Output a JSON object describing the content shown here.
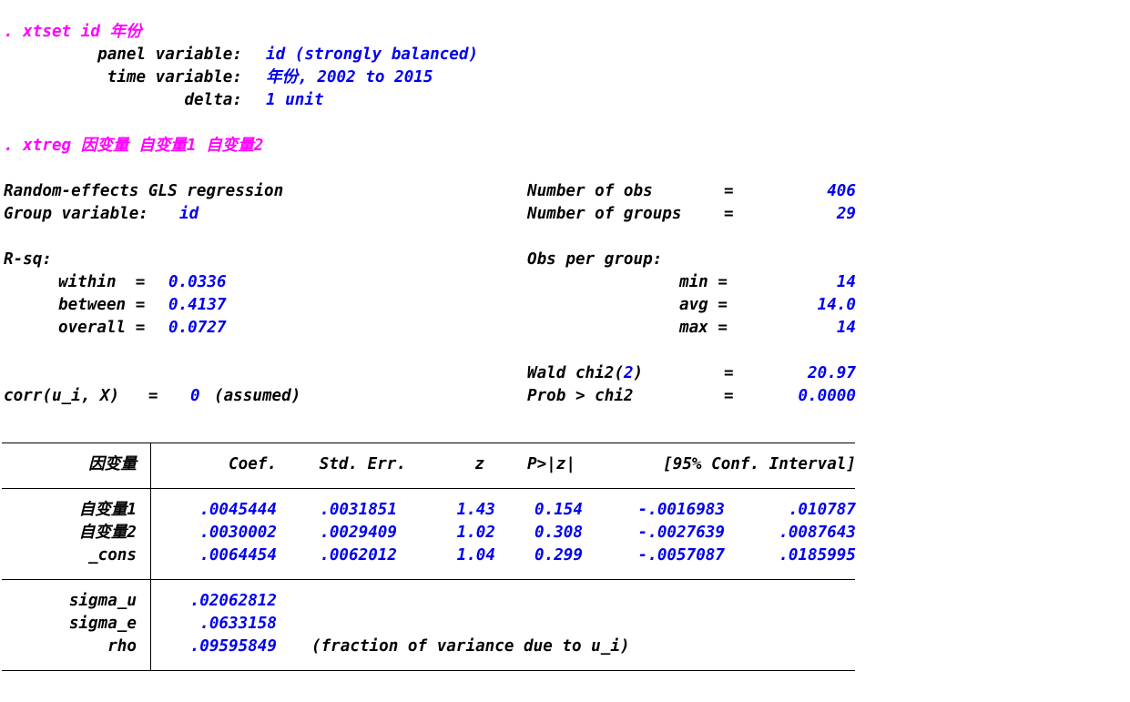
{
  "xtset": {
    "command": ". xtset id 年份",
    "panel_label": "panel variable:",
    "panel_value": "id (strongly balanced)",
    "time_label": "time variable:",
    "time_value": "年份, 2002 to 2015",
    "delta_label": "delta:",
    "delta_value": "1 unit"
  },
  "xtreg": {
    "command": ". xtreg 因变量 自变量1 自变量2",
    "title": "Random-effects GLS regression",
    "group_label": "Group variable:",
    "group_value": "id",
    "nobs_label": "Number of obs",
    "nobs_eq": "=",
    "nobs_value": "406",
    "ngroups_label": "Number of groups",
    "ngroups_eq": "=",
    "ngroups_value": "29",
    "rsq_label": "R-sq:",
    "within_label": "within  =",
    "within_value": "0.0336",
    "between_label": "between =",
    "between_value": "0.4137",
    "overall_label": "overall =",
    "overall_value": "0.0727",
    "obs_per_group_label": "Obs per group:",
    "min_label": "min =",
    "min_value": "14",
    "avg_label": "avg =",
    "avg_value": "14.0",
    "max_label": "max =",
    "max_value": "14",
    "wald_label": "Wald chi2(",
    "wald_df": "2",
    "wald_close": ")",
    "wald_eq": "=",
    "wald_value": "20.97",
    "prob_label": "Prob > chi2",
    "prob_eq": "=",
    "prob_value": "0.0000",
    "corr_label": "corr(u_i, X)   =",
    "corr_value": "0",
    "corr_suffix": "(assumed)"
  },
  "table": {
    "headers": {
      "depvar": "因变量",
      "coef": "Coef.",
      "stderr": "Std. Err.",
      "z": "z",
      "p": "P>|z|",
      "ci": "[95% Conf. Interval]"
    },
    "rows": [
      {
        "name": "自变量1",
        "coef": ".0045444",
        "se": ".0031851",
        "z": "1.43",
        "p": "0.154",
        "lo": "-.0016983",
        "hi": ".010787"
      },
      {
        "name": "自变量2",
        "coef": ".0030002",
        "se": ".0029409",
        "z": "1.02",
        "p": "0.308",
        "lo": "-.0027639",
        "hi": ".0087643"
      },
      {
        "name": "_cons",
        "coef": ".0064454",
        "se": ".0062012",
        "z": "1.04",
        "p": "0.299",
        "lo": "-.0057087",
        "hi": ".0185995"
      }
    ],
    "sigma_u_label": "sigma_u",
    "sigma_u_value": ".02062812",
    "sigma_e_label": "sigma_e",
    "sigma_e_value": ".0633158",
    "rho_label": "rho",
    "rho_value": ".09595849",
    "rho_note": "(fraction of variance due to u_i)"
  }
}
